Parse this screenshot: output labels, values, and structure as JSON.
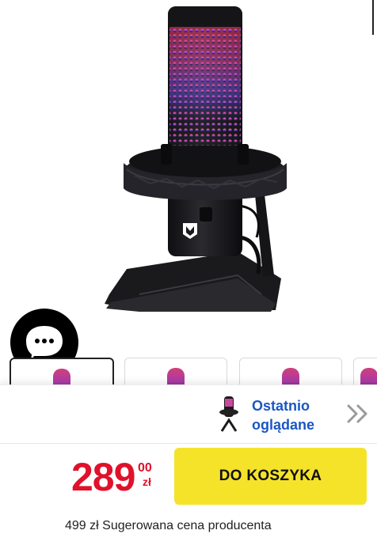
{
  "product": {
    "image_alt": "Czarny mikrofon z podświetleniem RGB i statywem",
    "thumbnails": [
      {
        "active": true
      },
      {
        "active": false
      },
      {
        "active": false
      },
      {
        "active": false
      }
    ]
  },
  "chat": {
    "icon": "chat-bubble-icon"
  },
  "recently_viewed": {
    "label_line1": "Ostatnio",
    "label_line2": "oglądane",
    "icon": "chevron-double-right-icon"
  },
  "price": {
    "main": "289",
    "cents": "00",
    "currency": "zł"
  },
  "cart_button": {
    "label": "DO KOSZYKA"
  },
  "suggested_price": {
    "amount": "499 zł",
    "label": "Sugerowana cena producenta"
  },
  "colors": {
    "price": "#e0112b",
    "cart_button": "#f5e32a",
    "link": "#1a56c4"
  }
}
